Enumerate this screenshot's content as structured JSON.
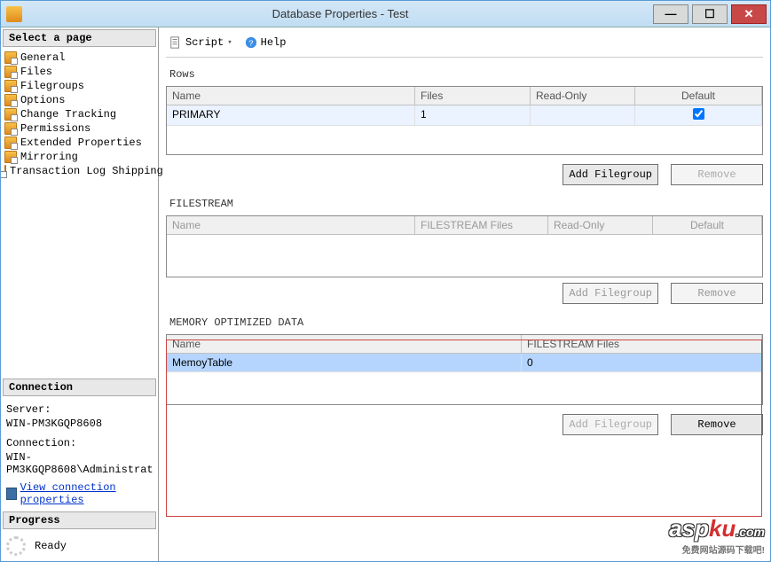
{
  "title": "Database Properties - Test",
  "sidebar": {
    "header": "Select a page",
    "items": [
      "General",
      "Files",
      "Filegroups",
      "Options",
      "Change Tracking",
      "Permissions",
      "Extended Properties",
      "Mirroring",
      "Transaction Log Shipping"
    ]
  },
  "connection": {
    "header": "Connection",
    "server_label": "Server:",
    "server_value": "WIN-PM3KGQP8608",
    "conn_label": "Connection:",
    "conn_value": "WIN-PM3KGQP8608\\Administrat",
    "link": "View connection properties"
  },
  "progress": {
    "header": "Progress",
    "status": "Ready"
  },
  "toolbar": {
    "script": "Script",
    "help": "Help"
  },
  "rows_section": {
    "label": "Rows",
    "headers": {
      "name": "Name",
      "files": "Files",
      "ro": "Read-Only",
      "def": "Default"
    },
    "row": {
      "name": "PRIMARY",
      "files": "1",
      "default_checked": true
    },
    "add": "Add Filegroup",
    "remove": "Remove"
  },
  "filestream_section": {
    "label": "FILESTREAM",
    "headers": {
      "name": "Name",
      "files": "FILESTREAM Files",
      "ro": "Read-Only",
      "def": "Default"
    },
    "add": "Add Filegroup",
    "remove": "Remove"
  },
  "memory_section": {
    "label": "MEMORY OPTIMIZED DATA",
    "headers": {
      "name": "Name",
      "files": "FILESTREAM Files"
    },
    "row": {
      "name": "MemoyTable",
      "files": "0"
    },
    "add": "Add Filegroup",
    "remove": "Remove"
  },
  "watermark": {
    "a": "asp",
    "b": "ku",
    "dot": ".com",
    "sub": "免费网站源码下载吧!"
  }
}
